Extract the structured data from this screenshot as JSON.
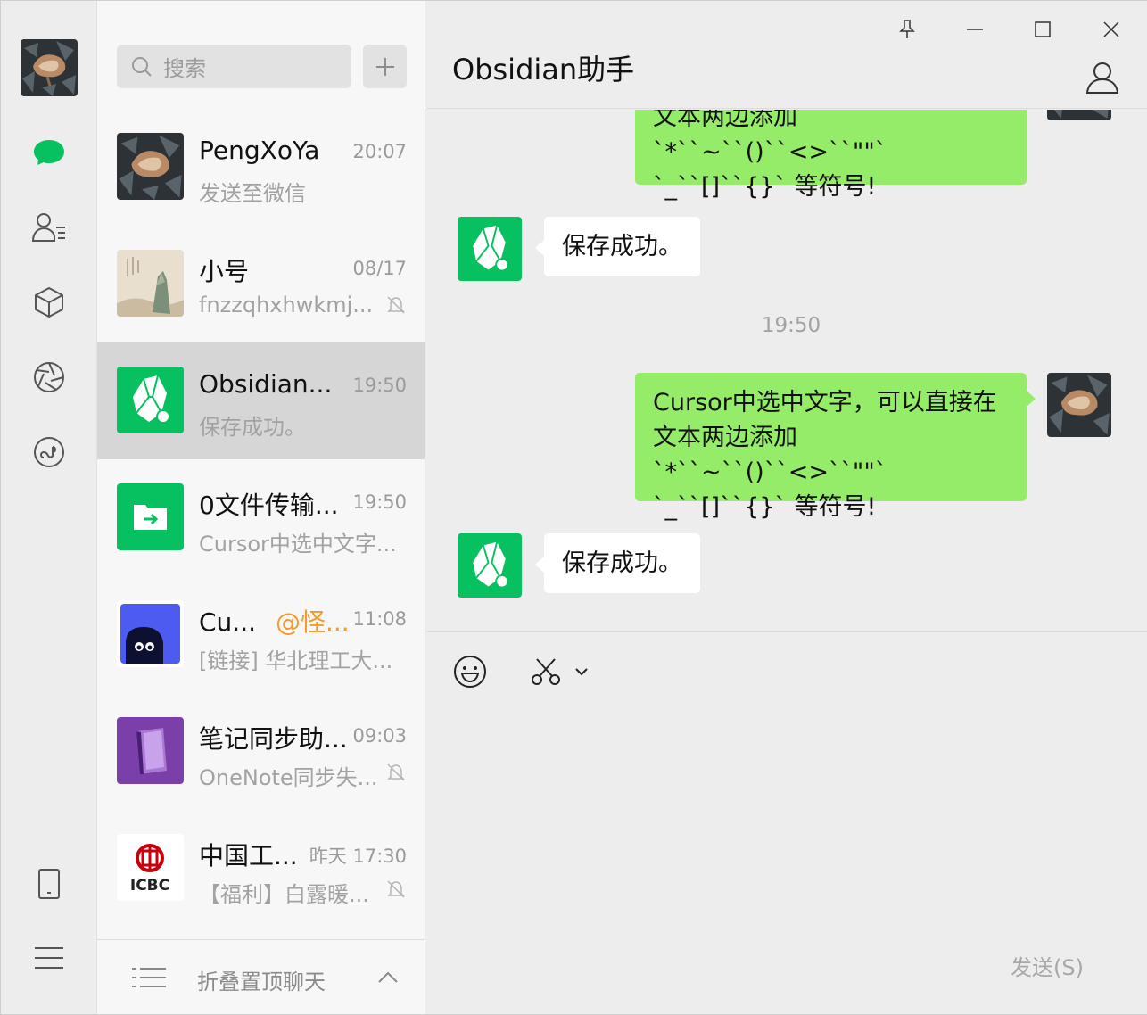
{
  "search": {
    "placeholder": "搜索"
  },
  "conversations": [
    {
      "name": "PengXoYa",
      "time": "20:07",
      "preview": "发送至微信",
      "muted": false
    },
    {
      "name": "小号",
      "time": "08/17",
      "preview": "fnzzqhxhwkmj...",
      "muted": true
    },
    {
      "name": "Obsidian...",
      "time": "19:50",
      "preview": "保存成功。",
      "muted": false
    },
    {
      "name": "0文件传输...",
      "time": "19:50",
      "preview": "Cursor中选中文字...",
      "muted": false
    },
    {
      "name": "Cu...",
      "mention": "@怪...",
      "time": "11:08",
      "preview": "[链接] 华北理工大...",
      "muted": false
    },
    {
      "name": "笔记同步助...",
      "time": "09:03",
      "preview": "OneNote同步失...",
      "muted": true
    },
    {
      "name": "中国工...",
      "time": "昨天 17:30",
      "preview": "【福利】白露暖...",
      "muted": true
    }
  ],
  "icbc_logo_text": "ICBC",
  "fold": {
    "label": "折叠置顶聊天"
  },
  "chat": {
    "title": "Obsidian助手",
    "messages": {
      "partial_top": {
        "line1": "文本两边添加`*``~``()``<>``\"\"`",
        "line2": "`_``[]``{}` 等符号!"
      },
      "reply1": "保存成功。",
      "time_divider": "19:50",
      "sent": {
        "line1": "Cursor中选中文字，可以直接在",
        "line2": "文本两边添加`*``~``()``<>``\"\"`",
        "line3": "`_``[]``{}` 等符号!"
      },
      "reply2": "保存成功。"
    },
    "send_label": "发送(S)"
  },
  "colors": {
    "accent": "#07c160",
    "bubble_me": "#95ec69",
    "bubble_them": "#ffffff",
    "mention": "#f39a2c"
  }
}
